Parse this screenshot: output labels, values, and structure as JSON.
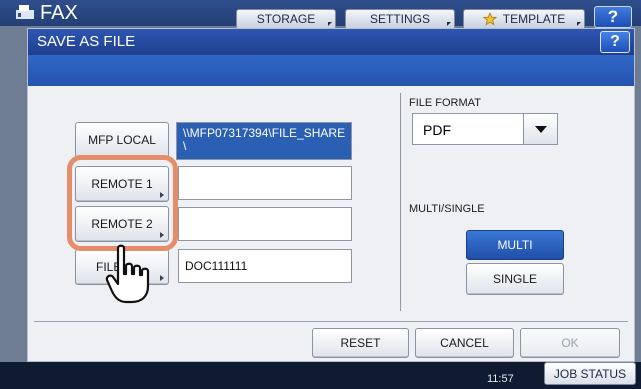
{
  "topbar": {
    "app_title": "FAX",
    "tabs": [
      "STORAGE",
      "SETTINGS",
      "TEMPLATE"
    ],
    "help_label": "?"
  },
  "dialog": {
    "title": "SAVE AS FILE",
    "help_label": "?",
    "destinations": [
      {
        "label": "MFP LOCAL",
        "value": "\\\\MFP07317394\\FILE_SHARE\n\\"
      },
      {
        "label": "REMOTE 1",
        "value": ""
      },
      {
        "label": "REMOTE 2",
        "value": ""
      },
      {
        "label": "FILE",
        "value": "DOC111111"
      }
    ],
    "file_format_label": "FILE FORMAT",
    "file_format_value": "PDF",
    "multi_single_label": "MULTI/SINGLE",
    "multi_label": "MULTI",
    "single_label": "SINGLE",
    "reset_label": "RESET",
    "cancel_label": "CANCEL",
    "ok_label": "OK"
  },
  "status": {
    "time": "11:57",
    "job_status_label": "JOB STATUS"
  },
  "colors": {
    "title_bar": "#1f3f8e",
    "selected_field": "#2b5fb3",
    "highlight_ring": "#e58d6a"
  },
  "icons": [
    "fax-icon",
    "pointing-hand-icon",
    "dropdown-arrow-icon",
    "star-icon"
  ]
}
